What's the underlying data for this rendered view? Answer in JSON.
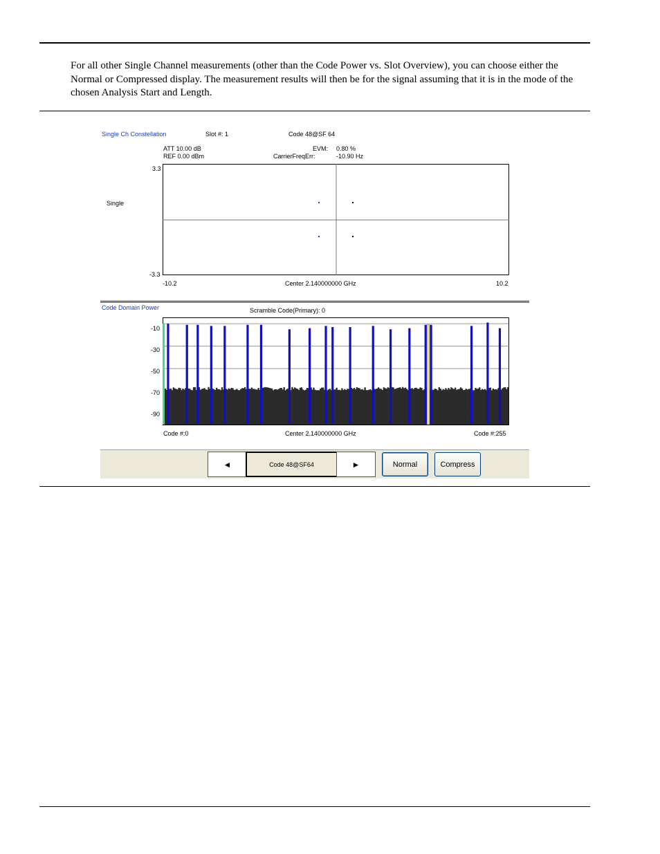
{
  "paragraph": "For all other Single Channel measurements (other than the Code Power vs. Slot Overview), you can choose either the Normal or Compressed display. The measurement results will then be for the signal assuming that it is in the mode of the chosen Analysis Start and Length.",
  "constellation": {
    "title": "Single Ch Constellation",
    "slot": "Slot #: 1",
    "code": "Code 48@SF 64",
    "att": "ATT 10.00 dB",
    "ref": "REF 0.00 dBm",
    "evm_label": "EVM:",
    "evm_value": "0.80 %",
    "cfe_label": "CarrierFreqErr:",
    "cfe_value": "-10.90 Hz",
    "side_label": "Single",
    "y_top": "3.3",
    "y_bottom": "-3.3",
    "x_left": "-10.2",
    "x_center": "Center 2.140000000 GHz",
    "x_right": "10.2",
    "colors": {
      "point_left": "#1f3fcf",
      "point_right": "#000000"
    }
  },
  "cdp": {
    "title": "Code Domain Power",
    "scramble": "Scramble Code(Primary): 0",
    "y_labels": [
      "-10",
      "-30",
      "-50",
      "-70",
      "-90"
    ],
    "x_left": "Code #:0",
    "x_center": "Center 2.140000000 GHz",
    "x_right": "Code #:255",
    "colors": {
      "noise": "#2b2b2b",
      "channel": "#1010c0",
      "pilot": "#40e080",
      "selected": "#f0e090"
    }
  },
  "controls": {
    "prev": "◄",
    "code": "Code 48@SF64",
    "next": "►",
    "normal": "Normal",
    "compress": "Compress"
  },
  "chart_data": {
    "type": "bar",
    "title": "Code Domain Power",
    "xlabel": "",
    "ylabel": "",
    "x_range": [
      0,
      255
    ],
    "ylim": [
      -100,
      -5
    ],
    "yticks": [
      -10,
      -30,
      -50,
      -70,
      -90
    ],
    "noise_floor": -68,
    "series": [
      {
        "name": "",
        "x": [
          3,
          17,
          25,
          35,
          45,
          62,
          72,
          93,
          108,
          120,
          125,
          138,
          155,
          168,
          182,
          194,
          198,
          228,
          240,
          249
        ],
        "values": [
          -10,
          -11,
          -11,
          -12,
          -12,
          -11,
          -11,
          -15,
          -14,
          -12,
          -13,
          -13,
          -12,
          -15,
          -14,
          -11,
          -11,
          -12,
          -9,
          -14
        ]
      }
    ],
    "selected_code": 196
  }
}
